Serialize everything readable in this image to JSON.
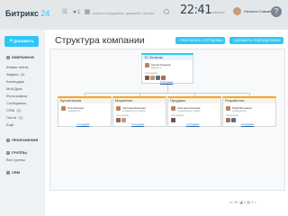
{
  "header": {
    "logo_text": "Битрикс",
    "logo_num": "24",
    "notify_count": "1",
    "search_placeholder": "искать сотрудника, документ, прочее",
    "time": "22:41",
    "time_status": "РАБОТАЮ",
    "user_name": "Наталья Савкина",
    "help_label": "?"
  },
  "sidebar": {
    "add_label": "ДОБАВИТЬ",
    "add_plus": "+",
    "items": [
      {
        "label": "ИЗБРАННОЕ",
        "section": true
      },
      {
        "label": "Живая лента"
      },
      {
        "label": "Задачи",
        "badge": "6"
      },
      {
        "label": "Календарь"
      },
      {
        "label": "Мой Диск"
      },
      {
        "label": "Фотографии"
      },
      {
        "label": "Сообщения"
      },
      {
        "label": "CRM",
        "badge": "1"
      },
      {
        "label": "Почта",
        "badge": "3"
      },
      {
        "label": "Ещё"
      },
      {
        "label": "ПРИЛОЖЕНИЯ",
        "section": true
      },
      {
        "label": "ГРУППЫ",
        "section": true
      },
      {
        "label": "Все группы"
      },
      {
        "label": "CRM",
        "section": true
      }
    ]
  },
  "main": {
    "title": "Структура компании",
    "btn_add_employee": "+ ПРИГЛАСИТЬ СОТРУДНИКА",
    "btn_add_dept": "+ ДОБАВИТЬ ПОДРАЗДЕЛЕНИЕ"
  },
  "org": {
    "root": {
      "title": "1С-Битрикс",
      "head_name": "Сергей Рыжиков",
      "head_role": "Директор",
      "staff_label": "Сотрудники",
      "link": "5 сотрудник"
    },
    "departments": [
      {
        "title": "Бухгалтерия",
        "head_name": "Ольга Белова",
        "head_role": "главный бух.",
        "link": "1 сотрудник"
      },
      {
        "title": "Маркетинг",
        "head_name": "Светлана Борисова",
        "head_role": "руководитель отдела",
        "staff_label": "Сотрудники",
        "link": "3 сотрудник"
      },
      {
        "title": "Продажи",
        "head_name": "Светлана Логинова",
        "head_role": "руководитель отдела",
        "staff_label": "Сотрудники",
        "link": "2 сотрудник"
      },
      {
        "title": "Разработка",
        "head_name": "Юрий Фоломеев",
        "head_role": "руководитель",
        "staff_label": "Сотрудники",
        "link": "4 сотрудник"
      }
    ]
  },
  "bottombar": {
    "text": "▭  ☏  ◪ 1  ▤ 1  ⌂"
  },
  "colors": {
    "accent": "#2fc6f6",
    "header_bg": "#e3e7ea",
    "sidebar_bg": "#eef2f4"
  }
}
